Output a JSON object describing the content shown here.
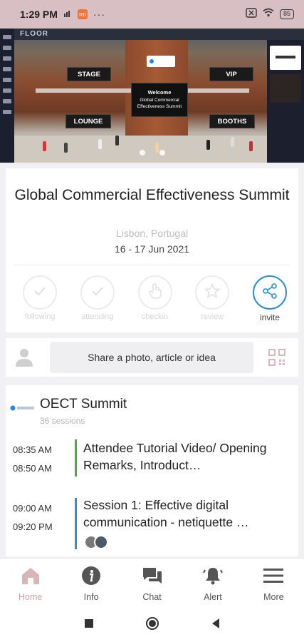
{
  "status_bar": {
    "time": "1:29 PM",
    "icons": [
      "sim-icon",
      "mi-app-icon",
      "more-dots-icon",
      "no-sim-icon",
      "wifi-icon",
      "battery-icon"
    ],
    "dots": "···",
    "battery": "85"
  },
  "hero": {
    "app_logo": "FLOOR",
    "signs": {
      "stage": "STAGE",
      "vip": "VIP",
      "lounge": "LOUNGE",
      "booths": "BOOTHS",
      "welcome_title": "Welcome",
      "welcome_sub": "Global Commercial Effectiveness Summit"
    }
  },
  "event": {
    "title": "Global Commercial Effectiveness Summit",
    "location": "Lisbon, Portugal",
    "dates": "16 - 17 Jun 2021",
    "actions": [
      {
        "label": "following",
        "icon": "check-icon",
        "active": false
      },
      {
        "label": "attending",
        "icon": "check-icon",
        "active": false
      },
      {
        "label": "checkin",
        "icon": "hand-icon",
        "active": false
      },
      {
        "label": "review",
        "icon": "star-icon",
        "active": false
      },
      {
        "label": "invite",
        "icon": "share-icon",
        "active": true
      }
    ]
  },
  "share": {
    "placeholder": "Share a photo, article or idea"
  },
  "agenda": {
    "title": "OECT Summit",
    "count": "36 sessions",
    "sessions": [
      {
        "start": "08:35 AM",
        "end": "08:50 AM",
        "title": "Attendee Tutorial Video/ Opening Remarks, Introduct…",
        "color": "#5c9e55"
      },
      {
        "start": "09:00 AM",
        "end": "09:20 PM",
        "title": "Session 1: Effective digital communication - netiquette …",
        "color": "#4f83c0"
      }
    ]
  },
  "bottom_nav": [
    {
      "label": "Home",
      "icon": "home-icon",
      "active": true
    },
    {
      "label": "Info",
      "icon": "info-icon",
      "active": false
    },
    {
      "label": "Chat",
      "icon": "chat-icon",
      "active": false
    },
    {
      "label": "Alert",
      "icon": "bell-icon",
      "active": false
    },
    {
      "label": "More",
      "icon": "menu-icon",
      "active": false
    }
  ],
  "colors": {
    "status_bar": "#d8bfc3",
    "accent_blue": "#2d8dd2",
    "home_active": "#c9a3a8"
  }
}
